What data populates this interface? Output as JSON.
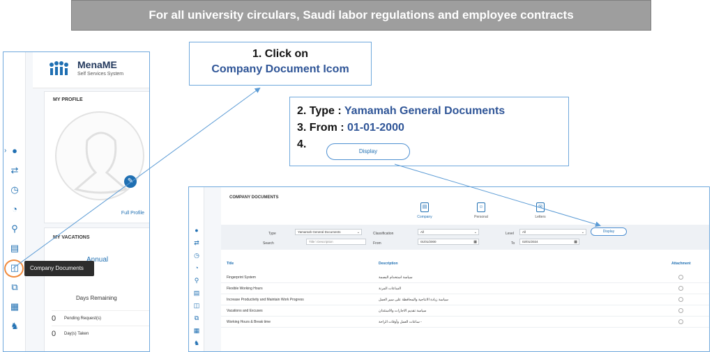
{
  "banner": {
    "text": "For all university circulars, Saudi labor regulations and employee contracts"
  },
  "callout1": {
    "line1": "1. Click on",
    "line2": "Company Document Icom"
  },
  "callout2": {
    "step2_label": "2. Type : ",
    "step2_value": "Yamamah General Documents",
    "step3_label": "3. From : ",
    "step3_value": "01-01-2000",
    "step4_label": "4.",
    "display_button": "Display"
  },
  "left_app": {
    "logo_title": "MenaME",
    "logo_sub": "Self Services System",
    "profile_title": "MY PROFILE",
    "full_profile": "Full Profile",
    "vacations_title": "MY VACATIONS",
    "annual": "Annual",
    "days_remaining": "Days Remaining",
    "pending_num": "0",
    "pending_label": "Pending Request(s)",
    "taken_num": "0",
    "taken_label": "Day(s) Taken",
    "tooltip": "Company Documents",
    "rail_icons": [
      "users-icon",
      "handshake-icon",
      "clock-icon",
      "gauge-icon",
      "search-clock-icon",
      "document-icon",
      "company-documents-icon",
      "copy-icon",
      "stripes-icon",
      "people-icon"
    ]
  },
  "right_app": {
    "title": "COMPANY DOCUMENTS",
    "tabs": [
      {
        "label": "Company",
        "icon": "document-icon"
      },
      {
        "label": "Personal",
        "icon": "document-person-icon"
      },
      {
        "label": "Letters",
        "icon": "letters-icon"
      }
    ],
    "filters": {
      "type_label": "Type",
      "type_value": "Yamamah General Documents",
      "classification_label": "Classification",
      "classification_value": "All",
      "level_label": "Level",
      "level_value": "All",
      "search_label": "Search",
      "search_placeholder": "Title \\ Description",
      "from_label": "From",
      "from_value": "01/01/2000",
      "to_label": "To",
      "to_value": "02/01/2024",
      "display": "Display"
    },
    "columns": {
      "title": "Title",
      "description": "Description",
      "attachment": "Attachment"
    },
    "rows": [
      {
        "title": "Fingerprint System",
        "description": "سياسة استخدام البصمة"
      },
      {
        "title": "Flexible Working Hours",
        "description": "الساعات المرنة"
      },
      {
        "title": "Increase Productivity and Maintain Work Progress",
        "description": "سياسة زيادة الانتاجية والمحافظة على سير العمل"
      },
      {
        "title": "Vacations and Excuses",
        "description": "سياسة تقديم الاجازات والاستئذان"
      },
      {
        "title": "Working Hours & Break time",
        "description": "ساعات العمل وأوقات الراحة -"
      }
    ]
  },
  "colors": {
    "accent": "#1f6fb2",
    "callout_value": "#2f5597",
    "highlight": "#f08a3c",
    "banner_bg": "#9e9e9e"
  }
}
